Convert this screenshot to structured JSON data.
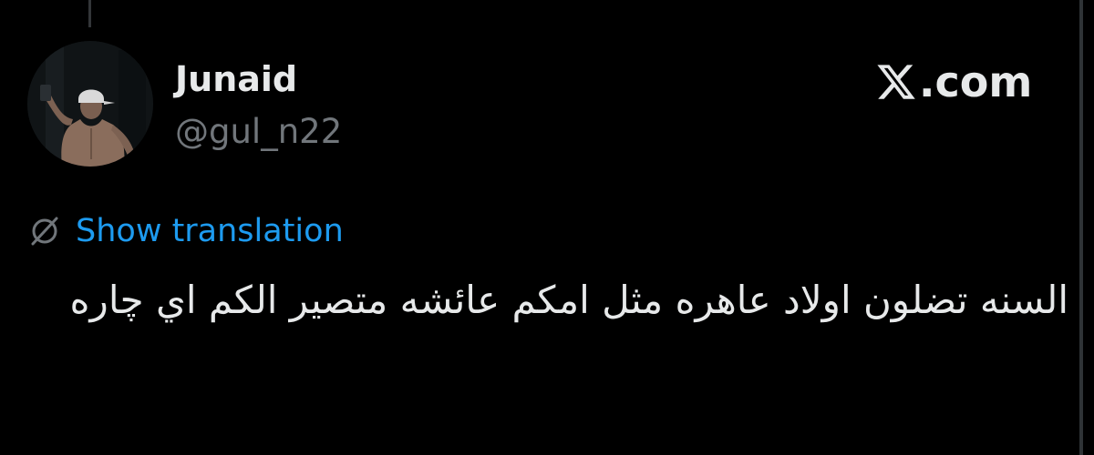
{
  "author": {
    "display_name": "Junaid",
    "handle": "@gul_n22"
  },
  "brand": {
    "text": ".com",
    "icon": "x-logo-icon"
  },
  "translation": {
    "link_label": "Show translation",
    "icon": "globe-icon"
  },
  "tweet": {
    "text": "السنه تضلون اولاد عاهره مثل امكم عائشه متصير الكم اي چاره"
  },
  "colors": {
    "background": "#000000",
    "primary_text": "#e7e9ea",
    "secondary_text": "#71767b",
    "link": "#1d9bf0",
    "border": "#2f3336"
  }
}
